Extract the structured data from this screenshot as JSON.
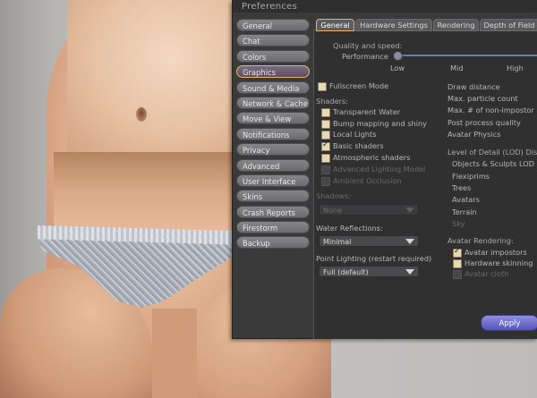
{
  "window": {
    "title": "Preferences"
  },
  "sidebar": {
    "items": [
      {
        "label": "General"
      },
      {
        "label": "Chat"
      },
      {
        "label": "Colors"
      },
      {
        "label": "Graphics",
        "active": true
      },
      {
        "label": "Sound & Media"
      },
      {
        "label": "Network & Cache"
      },
      {
        "label": "Move & View"
      },
      {
        "label": "Notifications"
      },
      {
        "label": "Privacy"
      },
      {
        "label": "Advanced"
      },
      {
        "label": "User Interface"
      },
      {
        "label": "Skins"
      },
      {
        "label": "Crash Reports"
      },
      {
        "label": "Firestorm"
      },
      {
        "label": "Backup"
      }
    ]
  },
  "tabs": [
    {
      "label": "General",
      "active": true
    },
    {
      "label": "Hardware Settings"
    },
    {
      "label": "Rendering"
    },
    {
      "label": "Depth of Field"
    }
  ],
  "quality": {
    "heading": "Quality and speed:",
    "slider_label": "Performance",
    "low": "Low",
    "mid": "Mid",
    "high": "High",
    "level": 0
  },
  "fullscreen": {
    "label": "Fullscreen Mode",
    "checked": false
  },
  "shaders": {
    "heading": "Shaders:",
    "items": [
      {
        "label": "Transparent Water",
        "checked": false,
        "enabled": true
      },
      {
        "label": "Bump mapping and shiny",
        "checked": false,
        "enabled": true
      },
      {
        "label": "Local Lights",
        "checked": false,
        "enabled": true
      },
      {
        "label": "Basic shaders",
        "checked": true,
        "enabled": true
      },
      {
        "label": "Atmospheric shaders",
        "checked": false,
        "enabled": true
      },
      {
        "label": "Advanced Lighting Model",
        "checked": false,
        "enabled": false
      },
      {
        "label": "Ambient Occlusion",
        "checked": false,
        "enabled": false
      }
    ]
  },
  "shadows": {
    "heading": "Shadows:",
    "value": "None"
  },
  "water_reflections": {
    "heading": "Water Reflections:",
    "value": "Minimal"
  },
  "point_lighting": {
    "heading": "Point Lighting (restart required)",
    "value": "Full (default)"
  },
  "right_column": {
    "draw_distance": "Draw distance",
    "max_particle": "Max. particle count",
    "max_non_impostor": "Max. # of non-impostor a",
    "post_process": "Post process quality",
    "avatar_physics": "Avatar Physics",
    "lod_heading": "Level of Detail (LOD) Dis",
    "lod_items": [
      "Objects & Sculpts LOD",
      "Flexiprims",
      "Trees",
      "Avatars",
      "Terrain",
      "Sky"
    ]
  },
  "avatar_rendering": {
    "heading": "Avatar Rendering:",
    "items": [
      {
        "label": "Avatar impostors",
        "checked": true,
        "enabled": true
      },
      {
        "label": "Hardware skinning",
        "checked": false,
        "enabled": true
      },
      {
        "label": "Avatar cloth",
        "checked": false,
        "enabled": false
      }
    ]
  },
  "apply_label": "Apply"
}
